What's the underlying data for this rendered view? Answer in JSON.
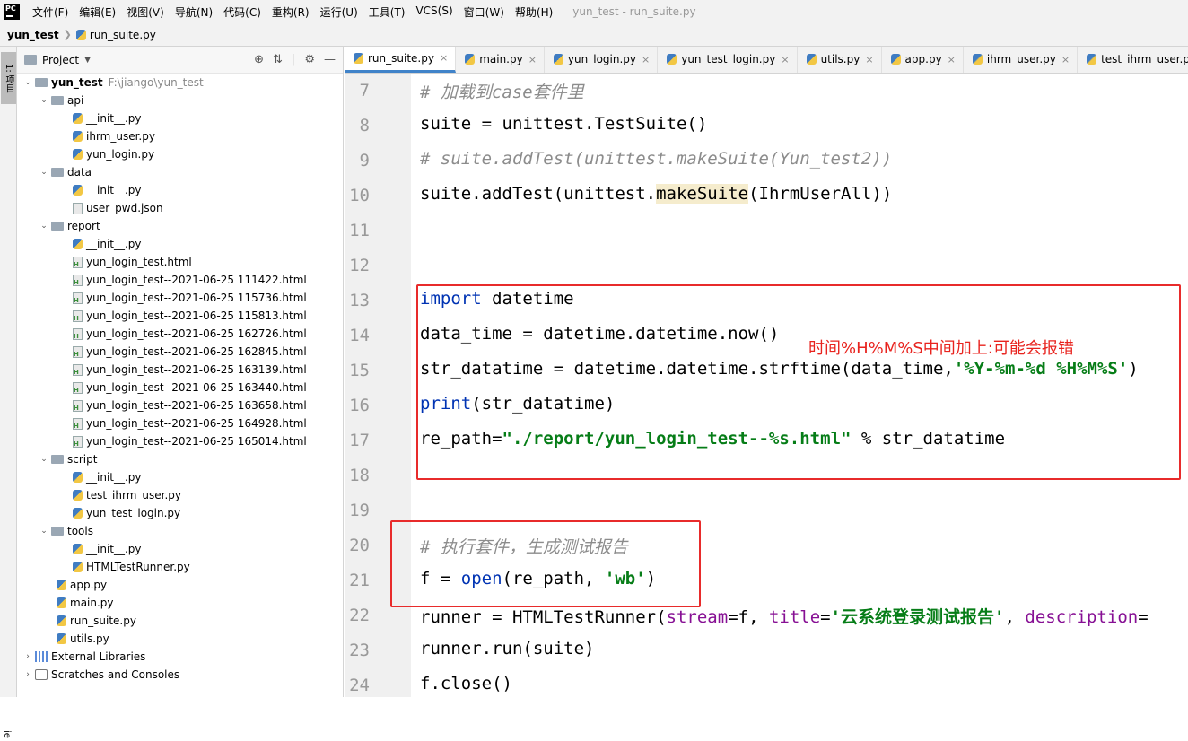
{
  "menubar": {
    "items": [
      "文件(F)",
      "编辑(E)",
      "视图(V)",
      "导航(N)",
      "代码(C)",
      "重构(R)",
      "运行(U)",
      "工具(T)",
      "VCS(S)",
      "窗口(W)",
      "帮助(H)"
    ],
    "window_title": "yun_test - run_suite.py"
  },
  "navbar": {
    "project": "yun_test",
    "file": "run_suite.py"
  },
  "leftstrip": {
    "project_label": "1: 项目",
    "bottom_label": "ie"
  },
  "project_panel": {
    "title": "Project",
    "tree": [
      {
        "label": "yun_test",
        "extra": "F:\\jiango\\yun_test",
        "depth": 0,
        "type": "folder",
        "open": true,
        "bold": true
      },
      {
        "label": "api",
        "depth": 1,
        "type": "folder",
        "open": true
      },
      {
        "label": "__init__.py",
        "depth": 2,
        "type": "py"
      },
      {
        "label": "ihrm_user.py",
        "depth": 2,
        "type": "py"
      },
      {
        "label": "yun_login.py",
        "depth": 2,
        "type": "py"
      },
      {
        "label": "data",
        "depth": 1,
        "type": "folder",
        "open": true
      },
      {
        "label": "__init__.py",
        "depth": 2,
        "type": "py"
      },
      {
        "label": "user_pwd.json",
        "depth": 2,
        "type": "json"
      },
      {
        "label": "report",
        "depth": 1,
        "type": "folder",
        "open": true
      },
      {
        "label": "__init__.py",
        "depth": 2,
        "type": "py"
      },
      {
        "label": "yun_login_test.html",
        "depth": 2,
        "type": "html"
      },
      {
        "label": "yun_login_test--2021-06-25 111422.html",
        "depth": 2,
        "type": "html"
      },
      {
        "label": "yun_login_test--2021-06-25 115736.html",
        "depth": 2,
        "type": "html"
      },
      {
        "label": "yun_login_test--2021-06-25 115813.html",
        "depth": 2,
        "type": "html"
      },
      {
        "label": "yun_login_test--2021-06-25 162726.html",
        "depth": 2,
        "type": "html"
      },
      {
        "label": "yun_login_test--2021-06-25 162845.html",
        "depth": 2,
        "type": "html"
      },
      {
        "label": "yun_login_test--2021-06-25 163139.html",
        "depth": 2,
        "type": "html"
      },
      {
        "label": "yun_login_test--2021-06-25 163440.html",
        "depth": 2,
        "type": "html"
      },
      {
        "label": "yun_login_test--2021-06-25 163658.html",
        "depth": 2,
        "type": "html"
      },
      {
        "label": "yun_login_test--2021-06-25 164928.html",
        "depth": 2,
        "type": "html"
      },
      {
        "label": "yun_login_test--2021-06-25 165014.html",
        "depth": 2,
        "type": "html"
      },
      {
        "label": "script",
        "depth": 1,
        "type": "folder",
        "open": true
      },
      {
        "label": "__init__.py",
        "depth": 2,
        "type": "py"
      },
      {
        "label": "test_ihrm_user.py",
        "depth": 2,
        "type": "py"
      },
      {
        "label": "yun_test_login.py",
        "depth": 2,
        "type": "py"
      },
      {
        "label": "tools",
        "depth": 1,
        "type": "folder",
        "open": true
      },
      {
        "label": "__init__.py",
        "depth": 2,
        "type": "py"
      },
      {
        "label": "HTMLTestRunner.py",
        "depth": 2,
        "type": "py"
      },
      {
        "label": "app.py",
        "depth": 1,
        "type": "py"
      },
      {
        "label": "main.py",
        "depth": 1,
        "type": "py"
      },
      {
        "label": "run_suite.py",
        "depth": 1,
        "type": "py"
      },
      {
        "label": "utils.py",
        "depth": 1,
        "type": "py"
      },
      {
        "label": "External Libraries",
        "depth": 0,
        "type": "lib",
        "closed": true
      },
      {
        "label": "Scratches and Consoles",
        "depth": 0,
        "type": "scratch",
        "closed": true
      }
    ]
  },
  "tabs": [
    {
      "label": "run_suite.py",
      "active": true
    },
    {
      "label": "main.py"
    },
    {
      "label": "yun_login.py"
    },
    {
      "label": "yun_test_login.py"
    },
    {
      "label": "utils.py"
    },
    {
      "label": "app.py"
    },
    {
      "label": "ihrm_user.py"
    },
    {
      "label": "test_ihrm_user.py"
    }
  ],
  "editor": {
    "lines": [
      {
        "n": "7",
        "html": "<span class='cm'># 加载到case套件里</span>"
      },
      {
        "n": "8",
        "html": "suite = unittest.TestSuite()"
      },
      {
        "n": "9",
        "html": "<span class='cm'># suite.addTest(unittest.makeSuite(Yun_test2))</span>"
      },
      {
        "n": "10",
        "html": "suite.addTest(unittest.<span class='hl'>makeSuite</span>(IhrmUserAll))"
      },
      {
        "n": "11",
        "html": ""
      },
      {
        "n": "12",
        "html": ""
      },
      {
        "n": "13",
        "html": "<span class='kw'>import</span> datetime"
      },
      {
        "n": "14",
        "html": "data_time = datetime.datetime.now()"
      },
      {
        "n": "15",
        "html": "str_datatime = datetime.datetime.strftime(data_time,<span class='str'>'%Y-%m-%d %H%M%S'</span>)"
      },
      {
        "n": "16",
        "html": "<span class='kw'>print</span>(str_datatime)"
      },
      {
        "n": "17",
        "html": "re_path=<span class='str'>\"./report/yun_login_test--%s.html\"</span> % str_datatime"
      },
      {
        "n": "18",
        "html": ""
      },
      {
        "n": "19",
        "html": ""
      },
      {
        "n": "20",
        "html": "<span class='cm'># 执行套件，生成测试报告</span>"
      },
      {
        "n": "21",
        "html": "f = <span class='kw'>open</span>(re_path, <span class='str'>'wb'</span>)"
      },
      {
        "n": "22",
        "html": "runner = HTMLTestRunner(<span class='param'>stream</span>=f, <span class='param'>title</span>=<span class='str'>'云系统登录测试报告'</span>, <span class='param'>description</span>="
      },
      {
        "n": "23",
        "html": "runner.run(suite)"
      },
      {
        "n": "24",
        "html": "f.close()"
      }
    ],
    "annotation": "时间%H%M%S中间加上:可能会报错"
  },
  "colors": {
    "annotation": "#e8231e",
    "keyword": "#0033b3",
    "string": "#067d17",
    "comment": "#8c8c8c"
  }
}
